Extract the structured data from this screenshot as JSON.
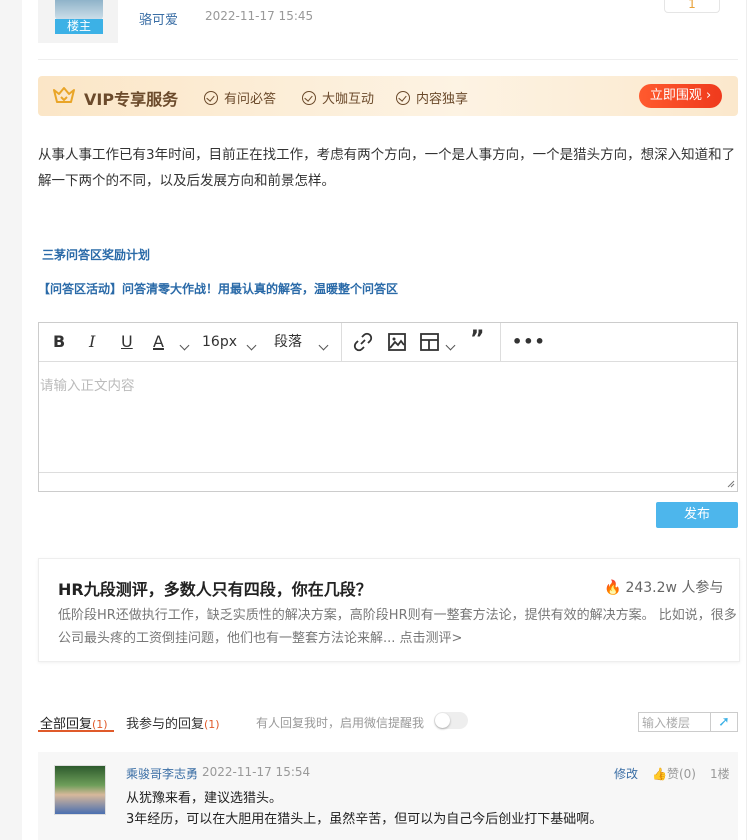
{
  "post": {
    "owner_tag": "楼主",
    "author": "骆可爱",
    "time": "2022-11-17 15:45",
    "floor_count": "1"
  },
  "vip": {
    "title": "VIP专享服务",
    "features": [
      "有问必答",
      "大咖互动",
      "内容独享"
    ],
    "cta": "立即围观 ›"
  },
  "content": "从事人事工作已有3年时间，目前正在找工作，考虑有两个方向，一个是人事方向，一个是猎头方向，想深入知道和了解一下两个的不同，以及后发展方向和前景怎样。",
  "links": {
    "plan": "三茅问答区奖励计划",
    "activity": "【问答区活动】问答清零大作战！用最认真的解答，温暖整个问答区"
  },
  "editor": {
    "font_size": "16px",
    "paragraph": "段落",
    "placeholder": "请输入正文内容",
    "publish": "发布"
  },
  "card": {
    "title": "HR九段测评，多数人只有四段，你在几段？",
    "count": "243.2w",
    "count_suffix": "人参与",
    "desc": "低阶段HR还做执行工作，缺乏实质性的解决方案，高阶段HR则有一整套方法论，提供有效的解决方案。 比如说，很多公司最头疼的工资倒挂问题，他们也有一整套方法论来解... 点击测评>"
  },
  "replies": {
    "tab_all": "全部回复",
    "tab_all_count": "(1)",
    "tab_mine": "我参与的回复",
    "tab_mine_count": "(1)",
    "notice": "有人回复我时，启用微信提醒我",
    "floor_placeholder": "输入楼层",
    "items": [
      {
        "name": "乘骏哥李志勇",
        "time": "2022-11-17 15:54",
        "edit": "修改",
        "like": "赞(0)",
        "floor": "1楼",
        "line1": "从犹豫来看，建议选猎头。",
        "line2": "3年经历，可以在大胆用在猎头上，虽然辛苦，但可以为自己今后创业打下基础啊。"
      }
    ]
  },
  "colors": {
    "accent": "#3cb1e6",
    "vip_button": "#ef3a1d",
    "reply_tab": "#e05a2a"
  }
}
